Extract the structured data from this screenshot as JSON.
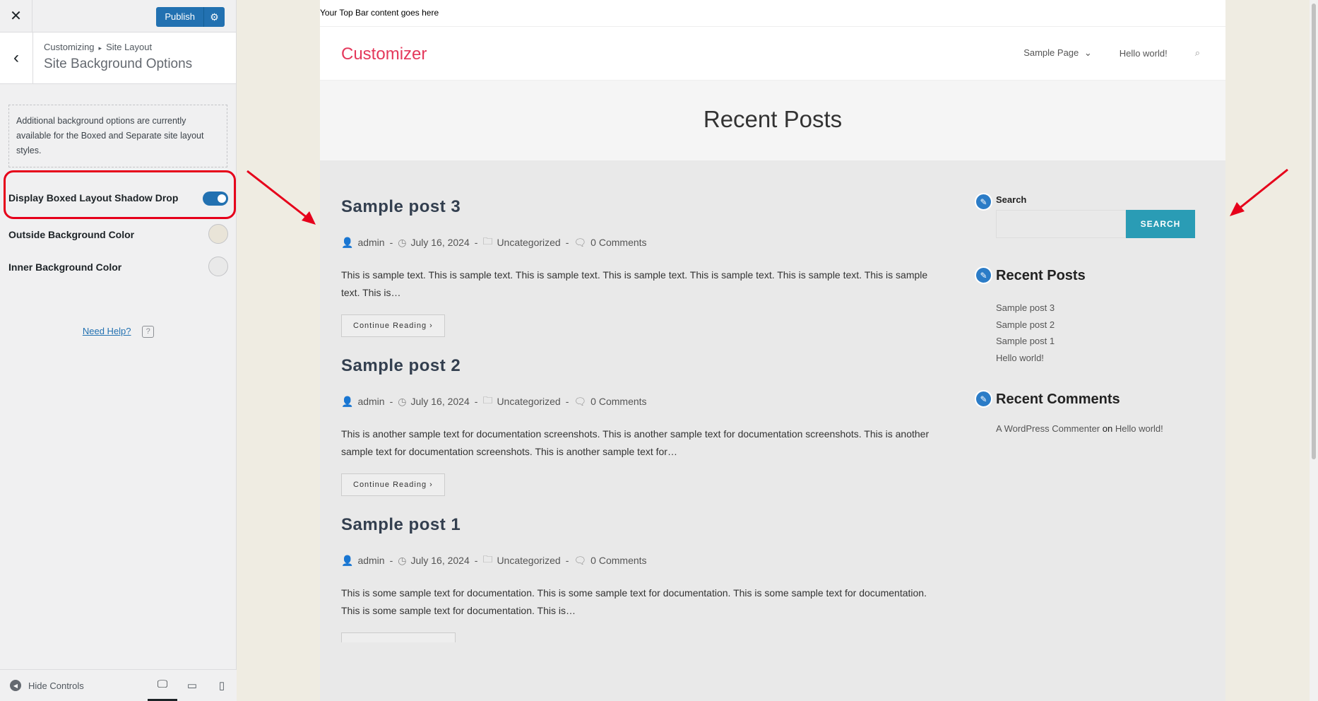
{
  "panel": {
    "close_icon": "close-icon",
    "publish_label": "Publish",
    "breadcrumb_root": "Customizing",
    "breadcrumb_section": "Site Layout",
    "section_title": "Site Background Options",
    "notice": "Additional background options are currently available for the Boxed and Separate site layout styles.",
    "controls": {
      "shadow_label": "Display Boxed Layout Shadow Drop",
      "shadow_enabled": true,
      "outside_label": "Outside Background Color",
      "outside_color": "#e9e4d8",
      "inner_label": "Inner Background Color",
      "inner_color": "#e9e9e9"
    },
    "help_label": "Need Help?",
    "hide_controls_label": "Hide Controls"
  },
  "site": {
    "top_bar": "Your Top Bar content goes here",
    "logo": "Customizer",
    "nav": [
      "Sample Page",
      "Hello world!"
    ],
    "page_title": "Recent Posts",
    "posts": [
      {
        "title": "Sample post 3",
        "author": "admin",
        "date": "July 16, 2024",
        "category": "Uncategorized",
        "comments": "0 Comments",
        "excerpt": "This is sample text. This is sample text. This is sample text. This is sample text. This is sample text. This is sample text. This is sample text. This is…",
        "button": "Continue Reading"
      },
      {
        "title": "Sample post 2",
        "author": "admin",
        "date": "July 16, 2024",
        "category": "Uncategorized",
        "comments": "0 Comments",
        "excerpt": "This is another sample text for documentation screenshots. This is another sample text for documentation screenshots. This is another sample text for documentation screenshots. This is another sample text for…",
        "button": "Continue Reading"
      },
      {
        "title": "Sample post 1",
        "author": "admin",
        "date": "July 16, 2024",
        "category": "Uncategorized",
        "comments": "0 Comments",
        "excerpt": "This is some sample text for documentation. This is some sample text for documentation. This is some sample text for documentation. This is some sample text for documentation. This is…",
        "button": ""
      }
    ],
    "sidebar": {
      "search_title": "Search",
      "search_button": "SEARCH",
      "recent_posts_title": "Recent Posts",
      "recent_posts": [
        "Sample post 3",
        "Sample post 2",
        "Sample post 1",
        "Hello world!"
      ],
      "recent_comments_title": "Recent Comments",
      "comment_author": "A WordPress Commenter",
      "comment_on": "on",
      "comment_post": "Hello world!"
    }
  },
  "colors": {
    "accent": "#2271b1",
    "logo": "#e4385b",
    "search_button": "#2a9cb5",
    "annotation": "#e6001a"
  }
}
